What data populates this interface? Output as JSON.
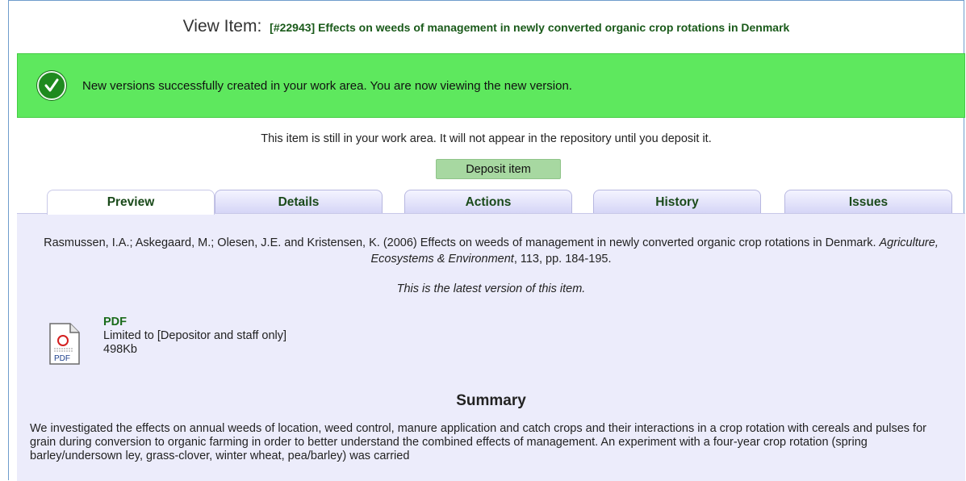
{
  "page": {
    "title_label": "View Item:",
    "item_title": "[#22943] Effects on weeds of management in newly converted organic crop rotations in Denmark"
  },
  "banner": {
    "icon": "check-icon",
    "message": "New versions successfully created in your work area. You are now viewing the new version.",
    "color": "#5ee85e"
  },
  "workarea_note": "This item is still in your work area. It will not appear in the repository until you deposit it.",
  "deposit_button_label": "Deposit item",
  "tabs": [
    {
      "label": "Preview",
      "active": true
    },
    {
      "label": "Details",
      "active": false
    },
    {
      "label": "Actions",
      "active": false
    },
    {
      "label": "History",
      "active": false
    },
    {
      "label": "Issues",
      "active": false
    }
  ],
  "citation": {
    "authors_year_title": "Rasmussen, I.A.; Askegaard, M.; Olesen, J.E. and Kristensen, K. (2006) Effects on weeds of management in newly converted organic crop rotations in Denmark.",
    "journal": "Agriculture, Ecosystems & Environment",
    "volume_pages": ", 113, pp. 184-195."
  },
  "latest_version_note": "This is the latest version of this item.",
  "document": {
    "icon": "pdf-file-icon",
    "icon_label": "PDF",
    "format": "PDF",
    "access": "Limited to [Depositor and staff only]",
    "size": "498Kb"
  },
  "summary": {
    "heading": "Summary",
    "text": "We investigated the effects on annual weeds of location, weed control, manure application and catch crops and their interactions in a crop rotation with cereals and pulses for grain during conversion to organic farming in order to better understand the combined effects of management. An experiment with a four-year crop rotation (spring barley/undersown ley, grass-clover, winter wheat, pea/barley) was carried"
  }
}
